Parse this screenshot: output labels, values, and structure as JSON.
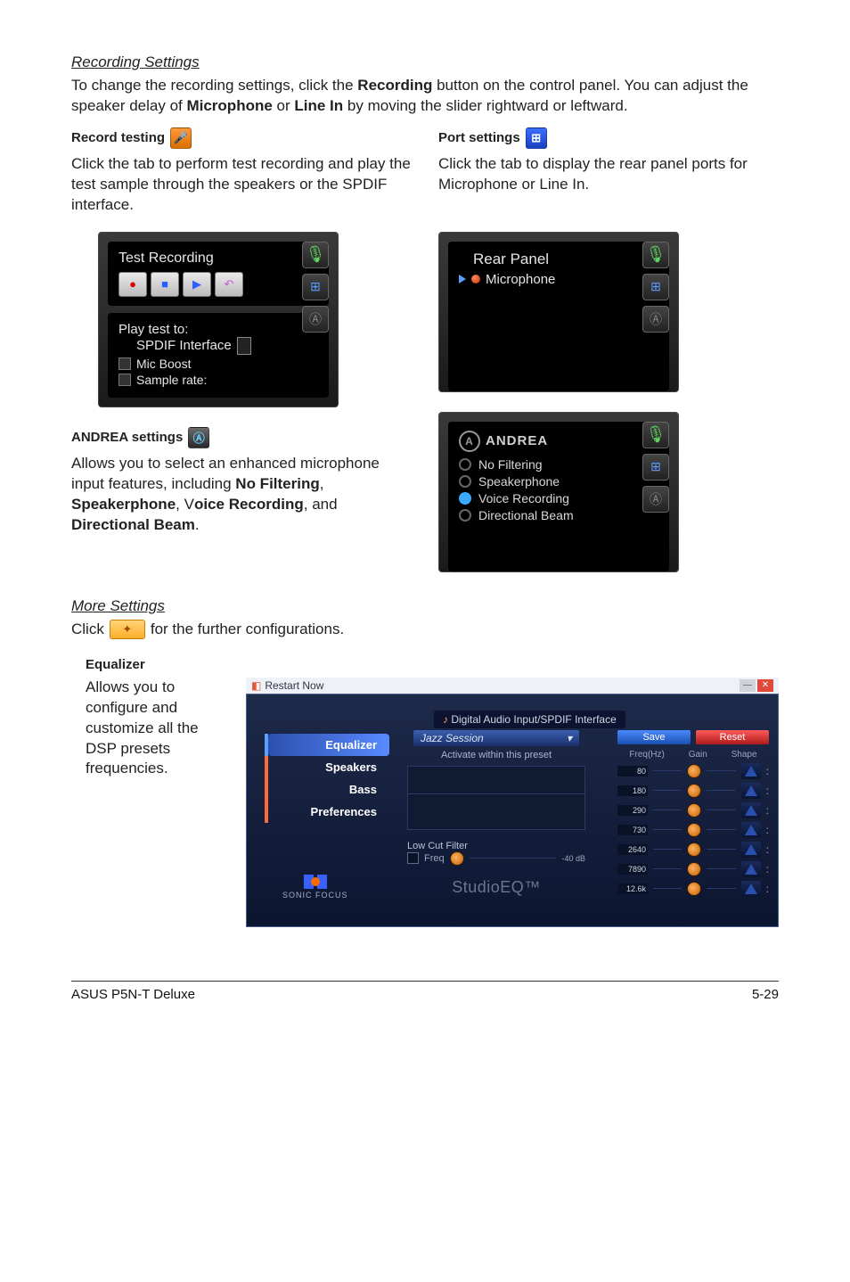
{
  "sections": {
    "recording": {
      "title": "Recording Settings",
      "intro_pre": "To change the recording settings, click the ",
      "intro_b1": "Recording",
      "intro_mid": " button on the control panel. You can adjust the speaker delay of ",
      "intro_b2": "Microphone",
      "intro_or": " or ",
      "intro_b3": "Line In",
      "intro_post": " by moving the slider rightward or leftward."
    },
    "record_test": {
      "heading": "Record testing",
      "desc": "Click the tab to perform test recording and play the test sample through the speakers or the SPDIF interface.",
      "panel_title": "Test Recording",
      "play_to": "Play test to:",
      "play_target": "SPDIF Interface",
      "mic_boost": "Mic Boost",
      "sample_rate": "Sample rate:"
    },
    "port": {
      "heading": "Port settings",
      "desc": "Click the tab to display the rear panel ports for Microphone or Line In.",
      "panel_title": "Rear Panel",
      "item": "Microphone"
    },
    "andrea": {
      "heading": "ANDREA settings",
      "desc_pre": "Allows you to select an enhanced microphone input features, including ",
      "b1": "No Filtering",
      "mid1": ", ",
      "b2": "Speakerphone",
      "mid2": ", V",
      "b3": "oice Recording",
      "mid3": ", and ",
      "b4": "Directional Beam",
      "post": ".",
      "logo": "ANDREA",
      "opts": [
        "No Filtering",
        "Speakerphone",
        "Voice Recording",
        "Directional Beam"
      ]
    },
    "more": {
      "title": "More Settings",
      "line_pre": "Click ",
      "line_post": " for the further configurations."
    },
    "equalizer": {
      "heading": "Equalizer",
      "desc": "Allows you to configure and customize all the DSP presets frequencies.",
      "win_title": "Restart Now",
      "top_title": "Digital Audio Input/SPDIF Interface",
      "tabs": [
        "Equalizer",
        "Speakers",
        "Bass",
        "Preferences"
      ],
      "sonic": "SONIC FOCUS",
      "preset": "Jazz Session",
      "activate": "Activate within this preset",
      "lcf": "Low Cut Filter",
      "freq_label": "Freq",
      "studio_a": "Studio",
      "studio_b": "EQ™",
      "btn_save": "Save",
      "btn_reset": "Reset",
      "head": [
        "Freq(Hz)",
        "Gain",
        "Shape"
      ],
      "rows": [
        "80",
        "180",
        "290",
        "730",
        "2640",
        "7890",
        "12.6k"
      ]
    }
  },
  "footer": {
    "left": "ASUS P5N-T Deluxe",
    "right": "5-29"
  }
}
